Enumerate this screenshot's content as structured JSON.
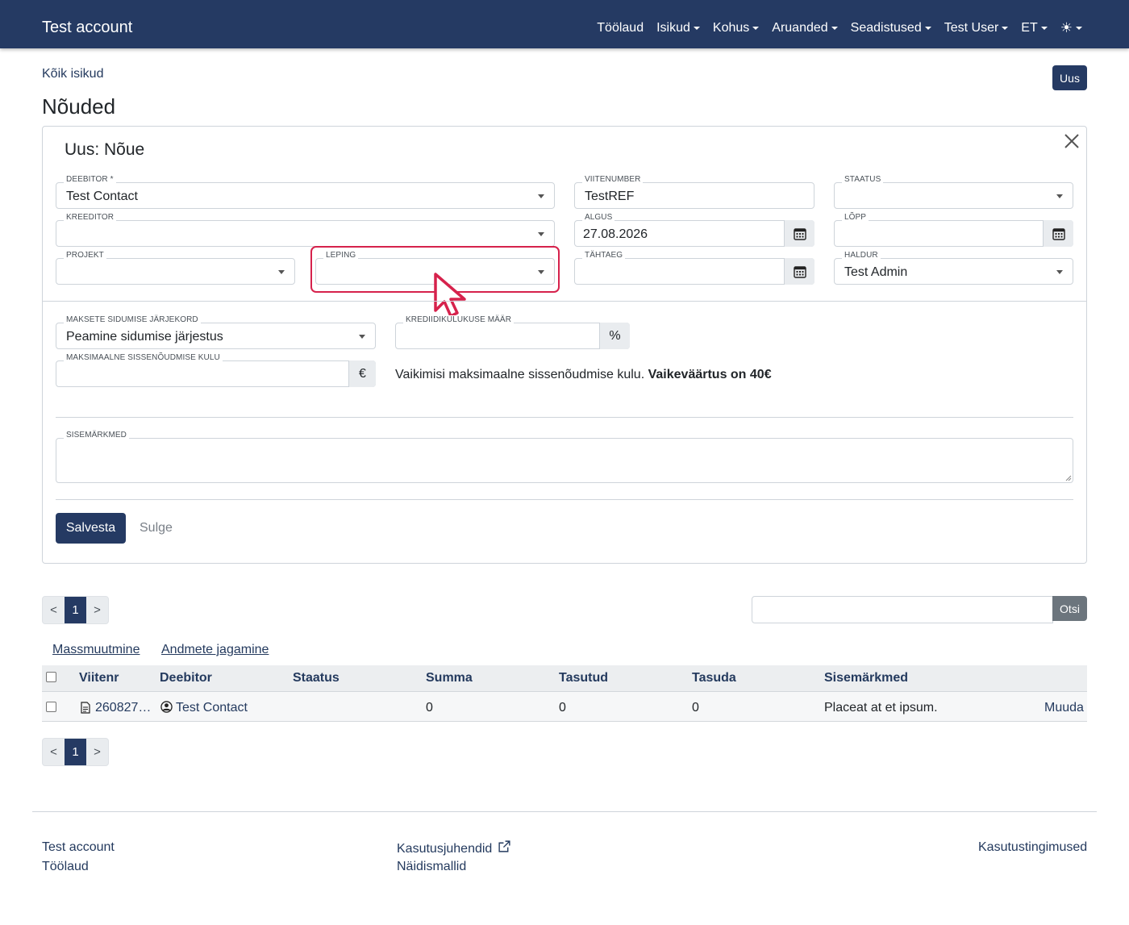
{
  "navbar": {
    "brand": "Test account",
    "items": [
      {
        "label": "Töölaud",
        "dropdown": false
      },
      {
        "label": "Isikud",
        "dropdown": true
      },
      {
        "label": "Kohus",
        "dropdown": true
      },
      {
        "label": "Aruanded",
        "dropdown": true
      },
      {
        "label": "Seadistused",
        "dropdown": true
      },
      {
        "label": "Test User",
        "dropdown": true
      },
      {
        "label": "ET",
        "dropdown": true
      }
    ],
    "theme_icon": "sun-icon"
  },
  "header": {
    "breadcrumb": "Kõik isikud",
    "new_button": "Uus",
    "title": "Nõuded"
  },
  "form": {
    "title": "Uus: Nõue",
    "deebitor": {
      "label": "Deebitor *",
      "value": "Test Contact"
    },
    "viitenumber": {
      "label": "Viitenumber",
      "value": "TestREF"
    },
    "staatus": {
      "label": "Staatus",
      "value": ""
    },
    "kreeditor": {
      "label": "Kreeditor",
      "value": ""
    },
    "algus": {
      "label": "Algus",
      "value": "27.08.2026"
    },
    "lopp": {
      "label": "Lõpp",
      "value": ""
    },
    "projekt": {
      "label": "Projekt",
      "value": ""
    },
    "leping": {
      "label": "Leping",
      "value": ""
    },
    "tahtaeg": {
      "label": "Tähtaeg",
      "value": ""
    },
    "haldur": {
      "label": "Haldur",
      "value": "Test Admin"
    },
    "jarjekord": {
      "label": "Maksete sidumise järjekord",
      "value": "Peamine sidumise järjestus"
    },
    "kulukus": {
      "label": "Krediidikulukuse määr",
      "value": "",
      "addon": "%"
    },
    "max_kulu": {
      "label": "Maksimaalne sissenõudmise kulu",
      "value": "",
      "addon": "€"
    },
    "hint_text": "Vaikimisi maksimaalne sissenõudmise kulu.",
    "hint_bold": "Vaikeväärtus on 40€",
    "sisemarkmed": {
      "label": "Sisemärkmed",
      "value": ""
    },
    "save_label": "Salvesta",
    "close_label": "Sulge"
  },
  "pagination": {
    "prev": "<",
    "page": "1",
    "next": ">"
  },
  "search": {
    "placeholder": "",
    "button": "Otsi"
  },
  "actions": {
    "mass_edit": "Massmuutmine",
    "share": "Andmete jagamine"
  },
  "table": {
    "columns": [
      "Viitenr",
      "Deebitor",
      "Staatus",
      "Summa",
      "Tasutud",
      "Tasuda",
      "Sisemärkmed"
    ],
    "rows": [
      {
        "viitenr": "260827…",
        "deebitor": "Test Contact",
        "staatus": "",
        "summa": "0",
        "tasutud": "0",
        "tasuda": "0",
        "sisemarkmed": "Placeat at et ipsum.",
        "action": "Muuda"
      }
    ]
  },
  "footer": {
    "col1": [
      "Test account",
      "Töölaud"
    ],
    "col2": [
      "Kasutusjuhendid",
      "Näidismallid"
    ],
    "col3": [
      "Kasutustingimused"
    ]
  },
  "colors": {
    "brand": "#253a63",
    "highlight": "#d6224c"
  }
}
